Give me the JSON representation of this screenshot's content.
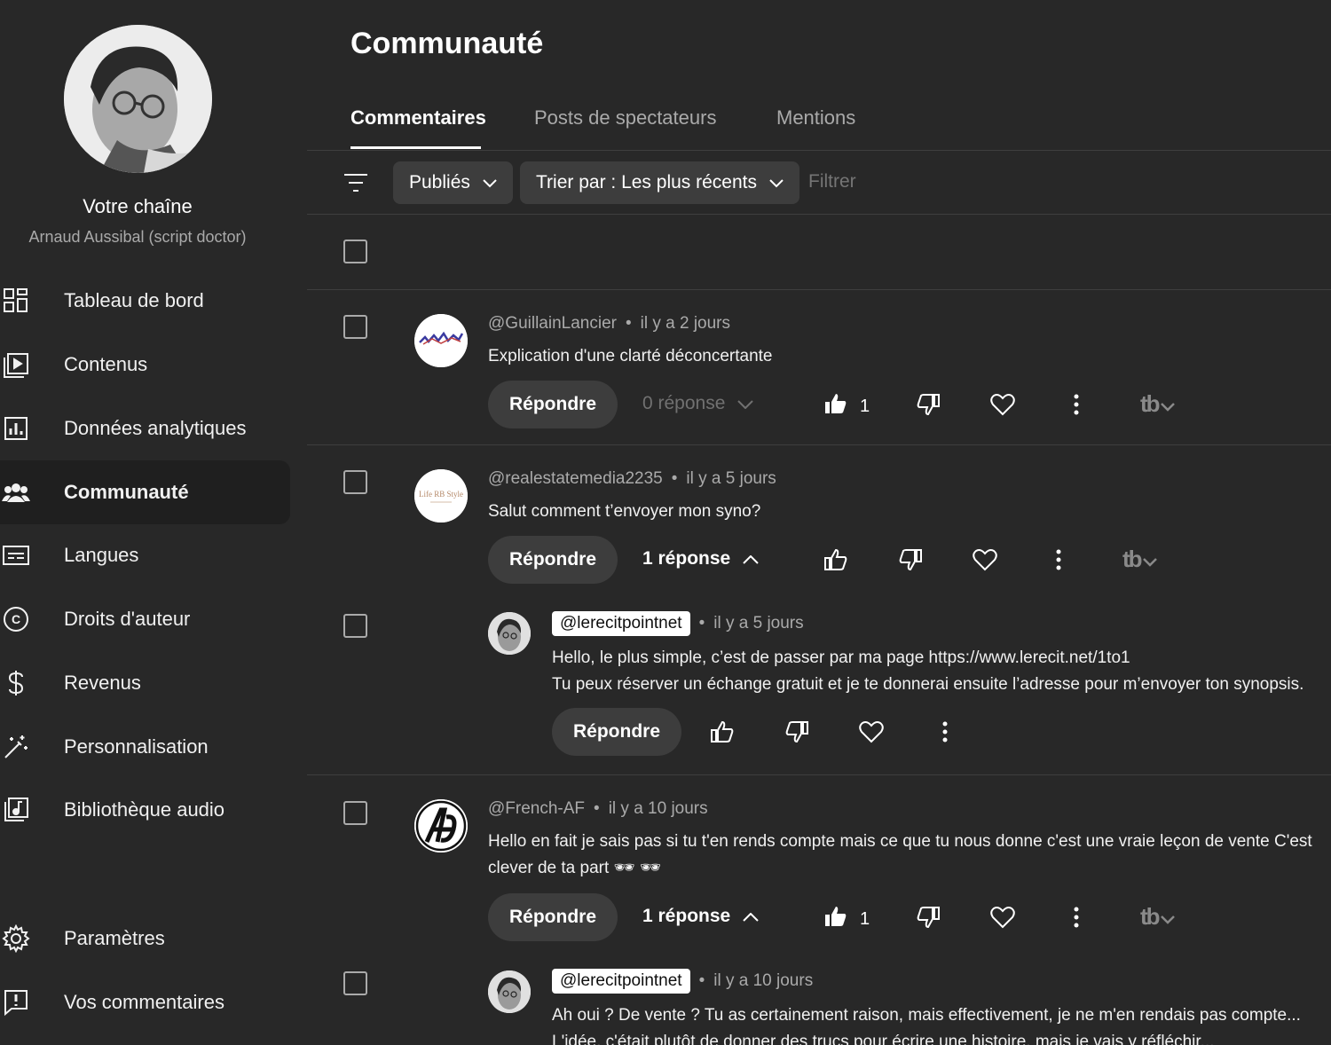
{
  "sidebar": {
    "channel_title": "Votre chaîne",
    "channel_name": "Arnaud Aussibal (script doctor)",
    "nav": [
      {
        "label": "Tableau de bord",
        "icon": "dashboard-icon"
      },
      {
        "label": "Contenus",
        "icon": "content-icon"
      },
      {
        "label": "Données analytiques",
        "icon": "analytics-icon"
      },
      {
        "label": "Communauté",
        "icon": "community-icon",
        "active": true
      },
      {
        "label": "Langues",
        "icon": "subtitles-icon"
      },
      {
        "label": "Droits d'auteur",
        "icon": "copyright-icon"
      },
      {
        "label": "Revenus",
        "icon": "dollar-icon"
      },
      {
        "label": "Personnalisation",
        "icon": "magic-wand-icon"
      },
      {
        "label": "Bibliothèque audio",
        "icon": "audio-library-icon"
      }
    ],
    "bottom_nav": [
      {
        "label": "Paramètres",
        "icon": "gear-icon"
      },
      {
        "label": "Vos commentaires",
        "icon": "feedback-icon"
      }
    ]
  },
  "page": {
    "title": "Communauté",
    "tabs": [
      "Commentaires",
      "Posts de spectateurs",
      "Mentions"
    ],
    "active_tab": "Commentaires"
  },
  "filters": {
    "status_chip": "Publiés",
    "sort_chip": "Trier par : Les plus récents",
    "filter_placeholder": "Filtrer"
  },
  "comments": [
    {
      "author": "@GuillainLancier",
      "time": "il y a 2 jours",
      "text": "Explication d'une clarté déconcertante",
      "reply_label": "Répondre",
      "replies_label": "0 réponse",
      "likes": "1",
      "liked": true
    },
    {
      "author": "@realestatemedia2235",
      "time": "il y a 5 jours",
      "text": "Salut comment t’envoyer mon syno?",
      "reply_label": "Répondre",
      "replies_label": "1 réponse",
      "likes": "",
      "liked": false,
      "avatar_text": "Life RB Style"
    },
    {
      "author": "@French-AF",
      "time": "il y a 10 jours",
      "text_line1": "Hello en fait je sais pas si tu t'en rends compte mais ce que tu nous donne c'est une vraie leçon de vente C'est",
      "text_line2": "clever de ta part 🕶 🕶",
      "reply_label": "Répondre",
      "replies_label": "1 réponse",
      "likes": "1",
      "liked": true
    }
  ],
  "replies": [
    {
      "author": "@lerecitpointnet",
      "time": "il y a 5 jours",
      "text_line1": "Hello, le plus simple, c’est de passer par ma page https://www.lerecit.net/1to1",
      "text_line2": "Tu peux réserver un échange gratuit et je te donnerai ensuite l’adresse pour m’envoyer ton synopsis.",
      "reply_label": "Répondre"
    },
    {
      "author": "@lerecitpointnet",
      "time": "il y a 10 jours",
      "text_line1": "Ah oui ? De vente ? Tu as certainement raison, mais effectivement, je ne m'en rendais pas compte...",
      "text_line2": "L'idée, c'était plutôt de donner des trucs pour écrire une histoire, mais je vais y réfléchir..."
    }
  ],
  "tubebuddy_label": "tb",
  "colors": {
    "background": "#282828",
    "active_nav": "#1f1f1f",
    "chip": "#3d3d3d",
    "muted": "#aaaaaa"
  }
}
